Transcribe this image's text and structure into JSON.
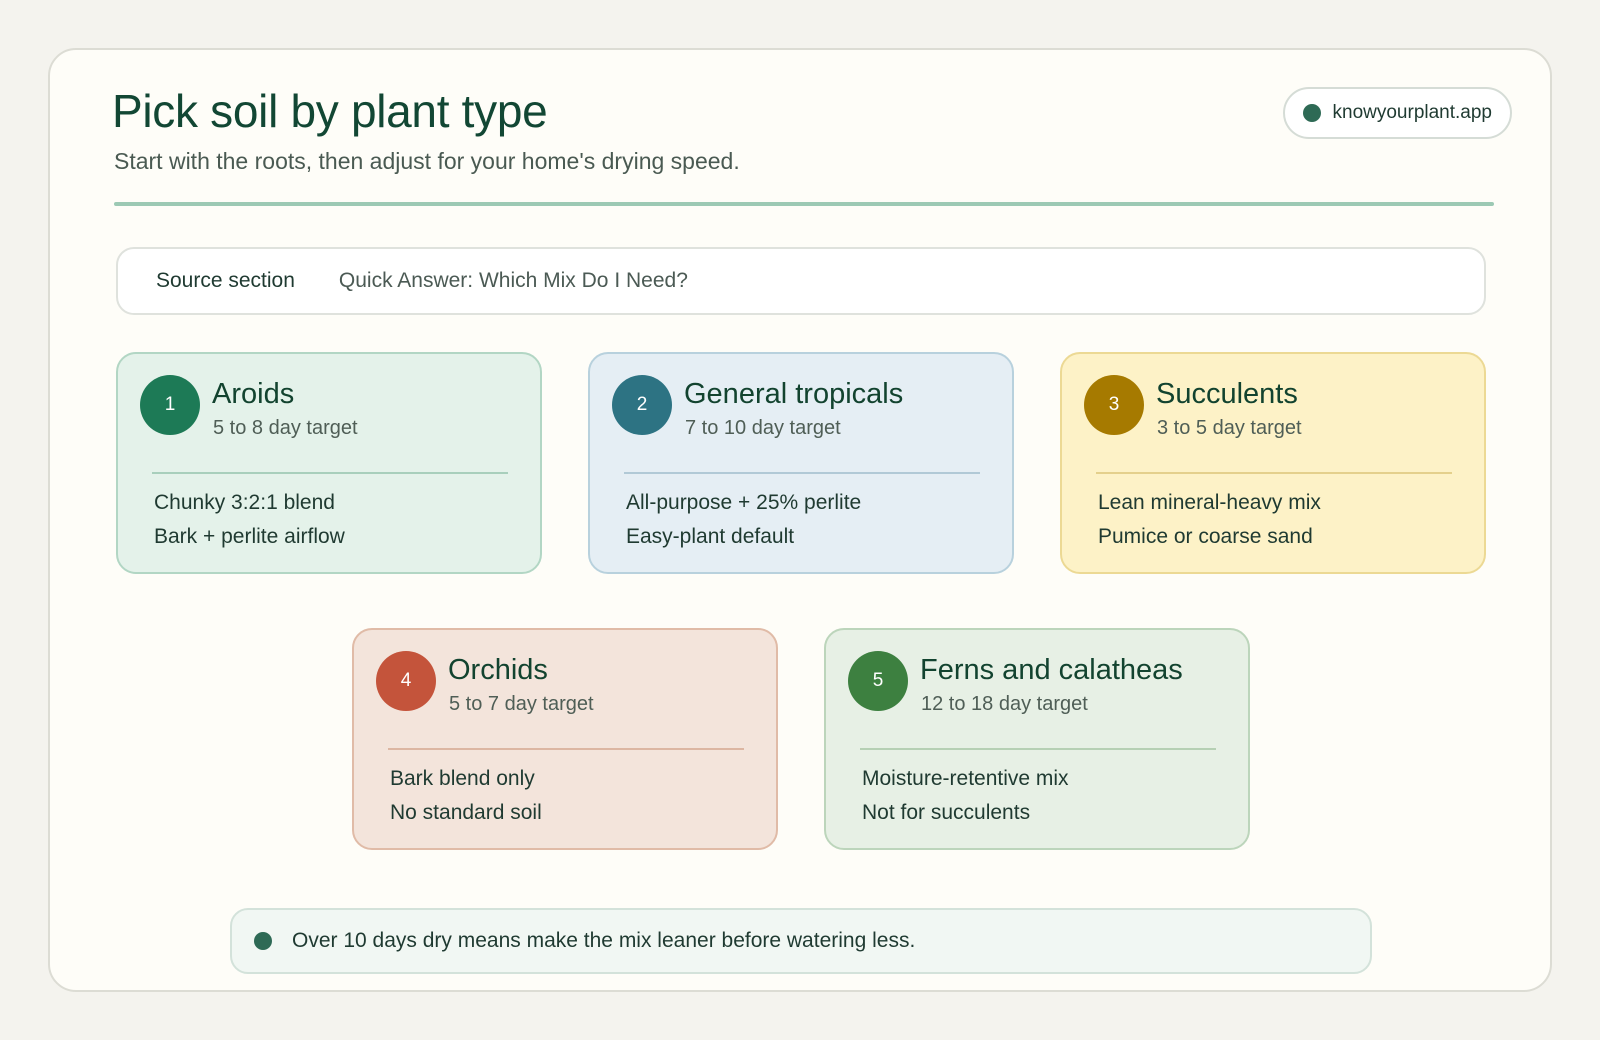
{
  "header": {
    "title": "Pick soil by plant type",
    "subtitle": "Start with the roots, then adjust for your home's drying speed.",
    "site": "knowyourplant.app"
  },
  "source": {
    "label": "Source section",
    "value": "Quick Answer: Which Mix Do I Need?"
  },
  "cards": [
    {
      "number": "1",
      "name": "Aroids",
      "target": "5 to 8 day target",
      "lines": [
        "Chunky 3:2:1 blend",
        "Bark + perlite airflow"
      ],
      "accent": "#1d7a56"
    },
    {
      "number": "2",
      "name": "General tropicals",
      "target": "7 to 10 day target",
      "lines": [
        "All-purpose + 25% perlite",
        "Easy-plant default"
      ],
      "accent": "#2d7383"
    },
    {
      "number": "3",
      "name": "Succulents",
      "target": "3 to 5 day target",
      "lines": [
        "Lean mineral-heavy mix",
        "Pumice or coarse sand"
      ],
      "accent": "#a67a00"
    },
    {
      "number": "4",
      "name": "Orchids",
      "target": "5 to 7 day target",
      "lines": [
        "Bark blend only",
        "No standard soil"
      ],
      "accent": "#c4543b"
    },
    {
      "number": "5",
      "name": "Ferns and calatheas",
      "target": "12 to 18 day target",
      "lines": [
        "Moisture-retentive mix",
        "Not for succulents"
      ],
      "accent": "#3d8040"
    }
  ],
  "tip": {
    "text": "Over 10 days dry means make the mix leaner before watering less."
  },
  "icons": {
    "site": "dot-icon",
    "tip": "dot-icon"
  }
}
